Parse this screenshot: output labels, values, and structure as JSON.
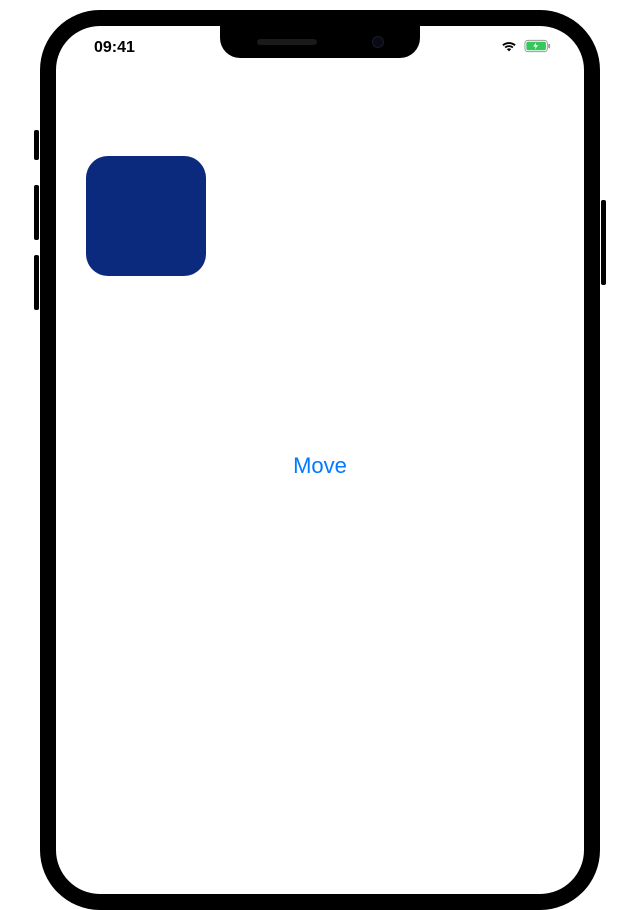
{
  "statusBar": {
    "time": "09:41"
  },
  "content": {
    "squareColor": "#0b2a7e",
    "moveButtonLabel": "Move"
  }
}
